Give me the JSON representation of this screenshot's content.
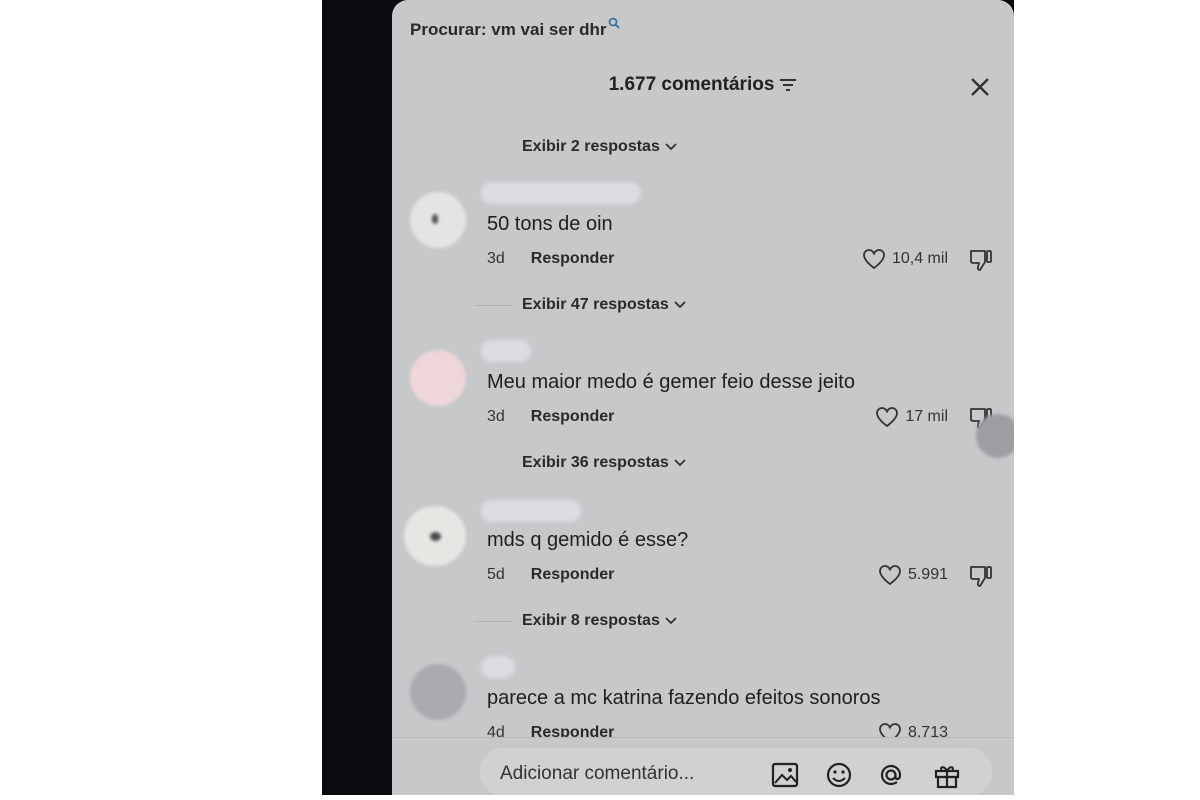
{
  "search": {
    "label": "Procurar: vm vai ser dhr"
  },
  "header": {
    "title": "1.677 comentários"
  },
  "replies": [
    "Exibir 2 respostas",
    "Exibir 47 respostas",
    "Exibir 36 respostas",
    "Exibir 8 respostas"
  ],
  "comments": [
    {
      "text": "50 tons de oin",
      "age": "3d",
      "reply_label": "Responder",
      "likes": "10,4 mil"
    },
    {
      "text": "Meu maior medo é gemer feio desse jeito",
      "age": "3d",
      "reply_label": "Responder",
      "likes": "17 mil"
    },
    {
      "text": "mds q gemido é esse?",
      "age": "5d",
      "reply_label": "Responder",
      "likes": "5.991"
    },
    {
      "text": "parece a mc katrina fazendo efeitos sonoros",
      "age": "4d",
      "reply_label": "Responder",
      "likes": "8.713"
    }
  ],
  "bottom": {
    "placeholder": "Adicionar comentário..."
  },
  "icons": [
    "search-icon",
    "filter-icon",
    "close-icon",
    "chevron-down-icon",
    "heart-icon",
    "dislike-icon",
    "image-icon",
    "emoji-icon",
    "mention-icon",
    "gift-icon"
  ]
}
